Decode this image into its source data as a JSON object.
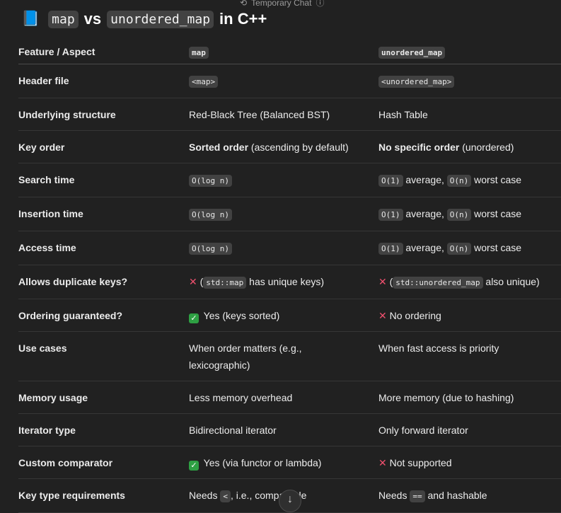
{
  "header": {
    "temporary_chat": "Temporary Chat"
  },
  "title": {
    "word1": "map",
    "vs": "vs",
    "word2": "unordered_map",
    "suffix": "in C++"
  },
  "table": {
    "headers": [
      "Feature / Aspect",
      "map",
      "unordered_map"
    ],
    "rows": [
      {
        "feature": "Header file",
        "map": "<map>",
        "umap": "<unordered_map>"
      },
      {
        "feature": "Underlying structure",
        "map": "Red-Black Tree (Balanced BST)",
        "umap": "Hash Table"
      },
      {
        "feature": "Key order",
        "map_bold": "Sorted order",
        "map_rest": " (ascending by default)",
        "umap_bold": "No specific order",
        "umap_rest": " (unordered)"
      },
      {
        "feature": "Search time",
        "map_code": "O(log n)",
        "umap_code1": "O(1)",
        "umap_mid": " average, ",
        "umap_code2": "O(n)",
        "umap_rest": " worst case"
      },
      {
        "feature": "Insertion time",
        "map_code": "O(log n)",
        "umap_code1": "O(1)",
        "umap_mid": " average, ",
        "umap_code2": "O(n)",
        "umap_rest": " worst case"
      },
      {
        "feature": "Access time",
        "map_code": "O(log n)",
        "umap_code1": "O(1)",
        "umap_mid": " average, ",
        "umap_code2": "O(n)",
        "umap_rest": " worst case"
      },
      {
        "feature": "Allows duplicate keys?",
        "map_pre": " (",
        "map_code": "std::map",
        "map_rest": " has unique keys)",
        "umap_pre": " (",
        "umap_code": "std::unordered_map",
        "umap_rest": " also unique)"
      },
      {
        "feature": "Ordering guaranteed?",
        "map": "Yes (keys sorted)",
        "umap": "No ordering"
      },
      {
        "feature": "Use cases",
        "map": "When order matters (e.g., lexicographic)",
        "umap": "When fast access is priority"
      },
      {
        "feature": "Memory usage",
        "map": "Less memory overhead",
        "umap": "More memory (due to hashing)"
      },
      {
        "feature": "Iterator type",
        "map": "Bidirectional iterator",
        "umap": "Only forward iterator"
      },
      {
        "feature": "Custom comparator",
        "map": "Yes (via functor or lambda)",
        "umap": "Not supported"
      },
      {
        "feature": "Key type requirements",
        "map_pre": "Needs ",
        "map_code": "<",
        "map_rest": ", i.e., comparable",
        "umap_pre": "Needs ",
        "umap_code": "==",
        "umap_rest": " and hashable"
      }
    ]
  },
  "icons": {
    "check_color": "#2ea043",
    "cross_color": "#f0506e"
  }
}
